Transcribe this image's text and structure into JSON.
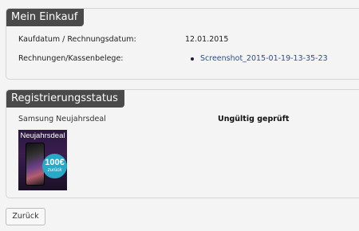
{
  "purchase": {
    "title": "Mein Einkauf",
    "rows": [
      {
        "label": "Kaufdatum / Rechnungsdatum:",
        "value": "12.01.2015"
      },
      {
        "label": "Rechnungen/Kassenbelege:",
        "link": "Screenshot_2015-01-19-13-35-23"
      }
    ]
  },
  "registration": {
    "title": "Registrierungsstatus",
    "deal_name": "Samsung Neujahrsdeal",
    "status": "Ungültig geprüft",
    "image": {
      "title": "Neujahrsdeal",
      "badge_value": "100",
      "badge_suffix": "€",
      "badge_caption": "zurück"
    }
  },
  "actions": {
    "back_label": "Zurück"
  },
  "colors": {
    "tab_background": "#4a4a4a",
    "link": "#2a4f8f",
    "badge": "#27a9c8"
  }
}
